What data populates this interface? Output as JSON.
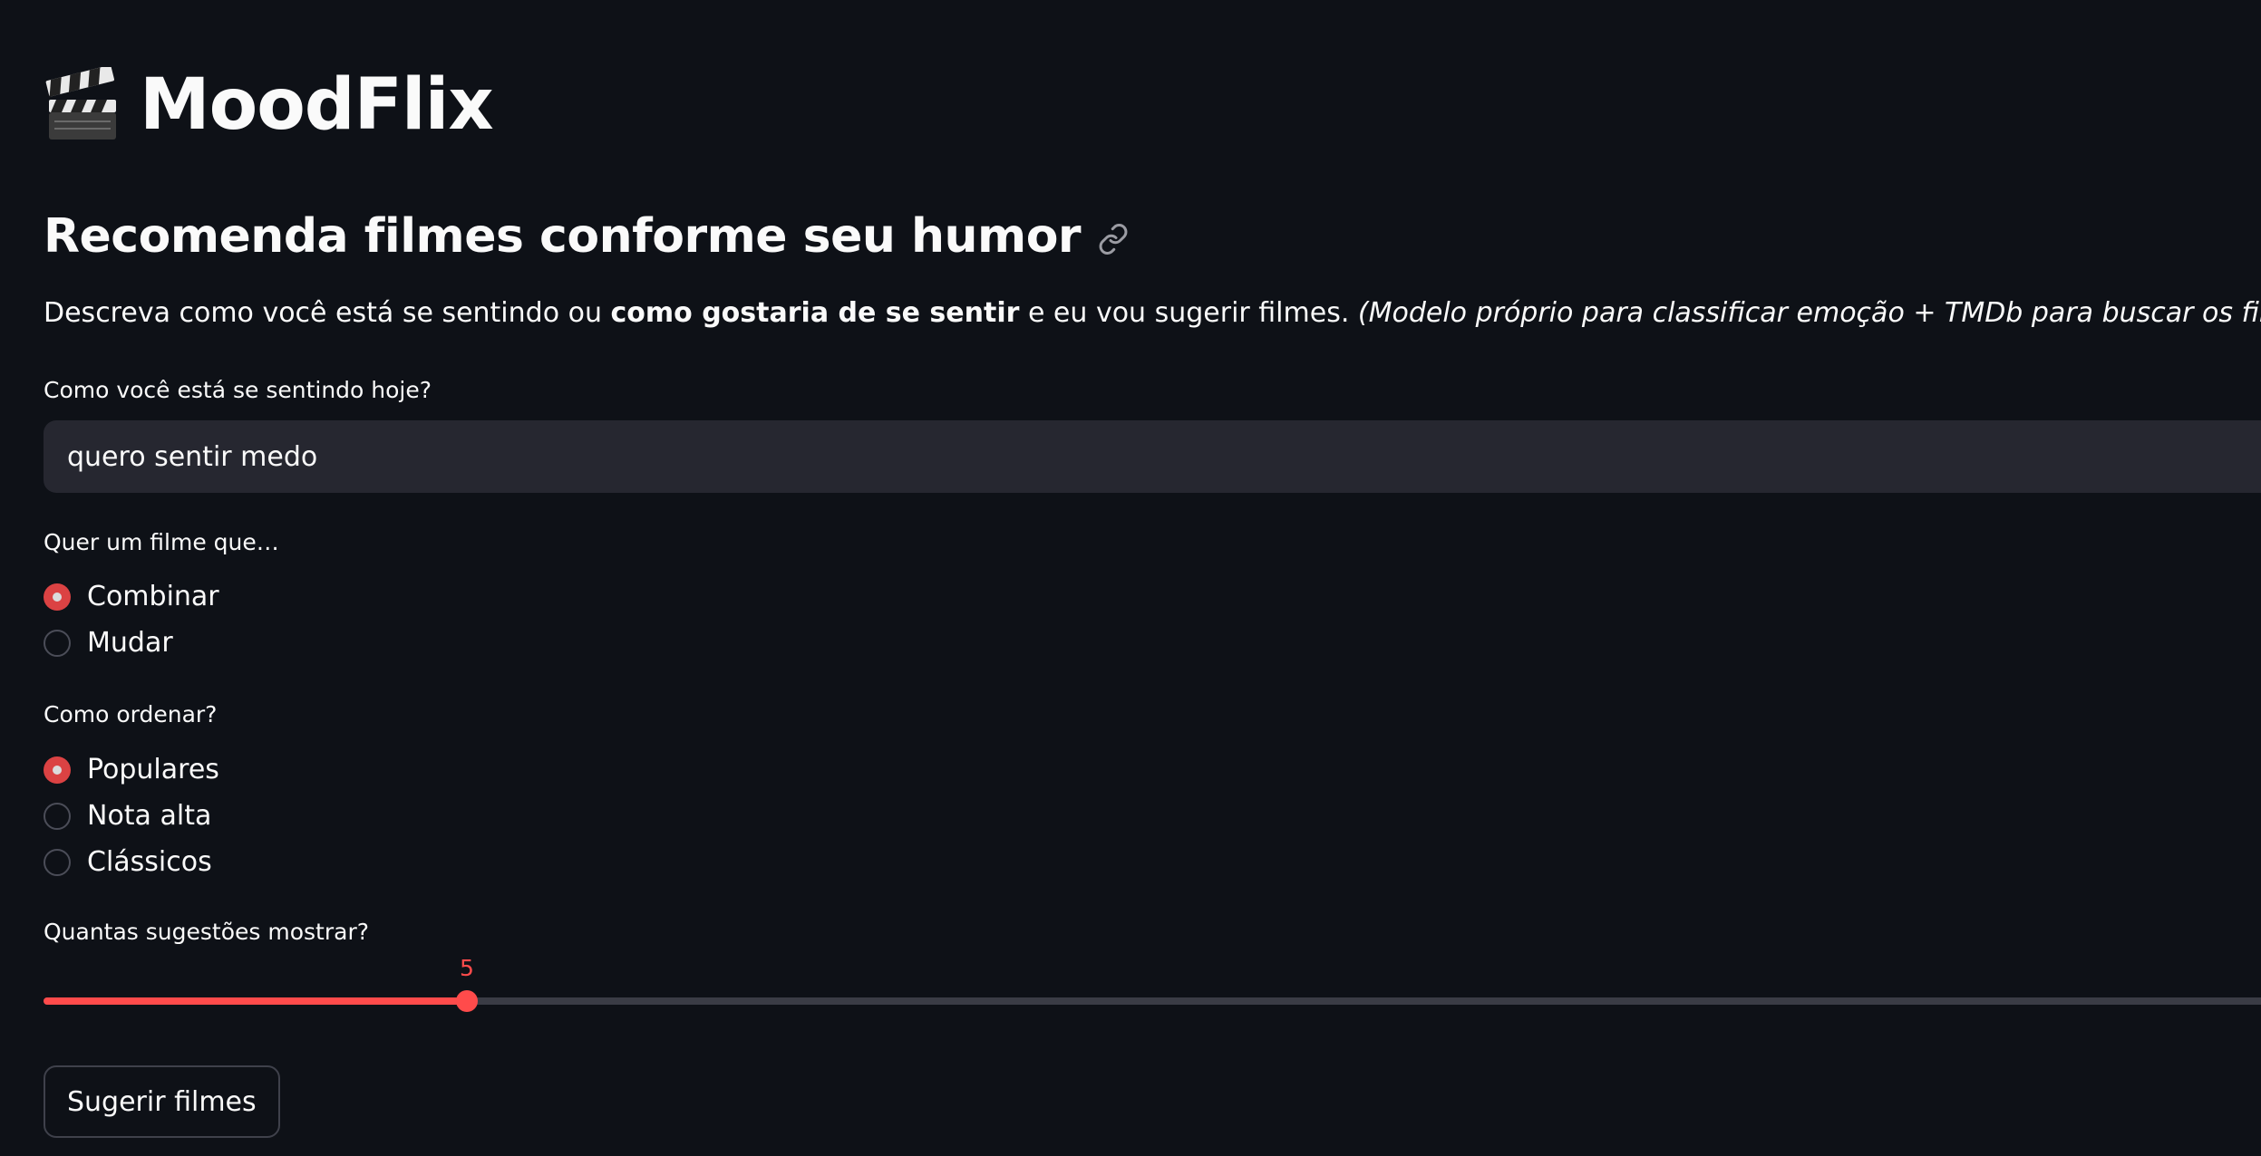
{
  "app": {
    "title": "MoodFlix",
    "subheader": "Recomenda filmes conforme seu humor"
  },
  "description": {
    "part1": "Descreva como você está se sentindo ou ",
    "bold": "como gostaria de se sentir",
    "part2": " e eu vou sugerir filmes. ",
    "italic": "(Modelo próprio para classificar emoção + TMDb para buscar os filmes.)"
  },
  "mood_input": {
    "label": "Como você está se sentindo hoje?",
    "value": "quero sentir medo"
  },
  "match_radio": {
    "label": "Quer um filme que…",
    "options": [
      "Combinar",
      "Mudar"
    ],
    "selected": "Combinar"
  },
  "order_radio": {
    "label": "Como ordenar?",
    "options": [
      "Populares",
      "Nota alta",
      "Clássicos"
    ],
    "selected": "Populares"
  },
  "count_slider": {
    "label": "Quantas sugestões mostrar?",
    "value": 5,
    "value_label": "5",
    "fraction": 0.19
  },
  "submit_button": {
    "label": "Sugerir filmes"
  },
  "colors": {
    "background": "#0e1117",
    "accent": "#ff4b4b",
    "input_bg": "#262730",
    "text": "#fafafa"
  },
  "icons": {
    "title": "clapper-board-icon",
    "anchor": "link-icon"
  }
}
